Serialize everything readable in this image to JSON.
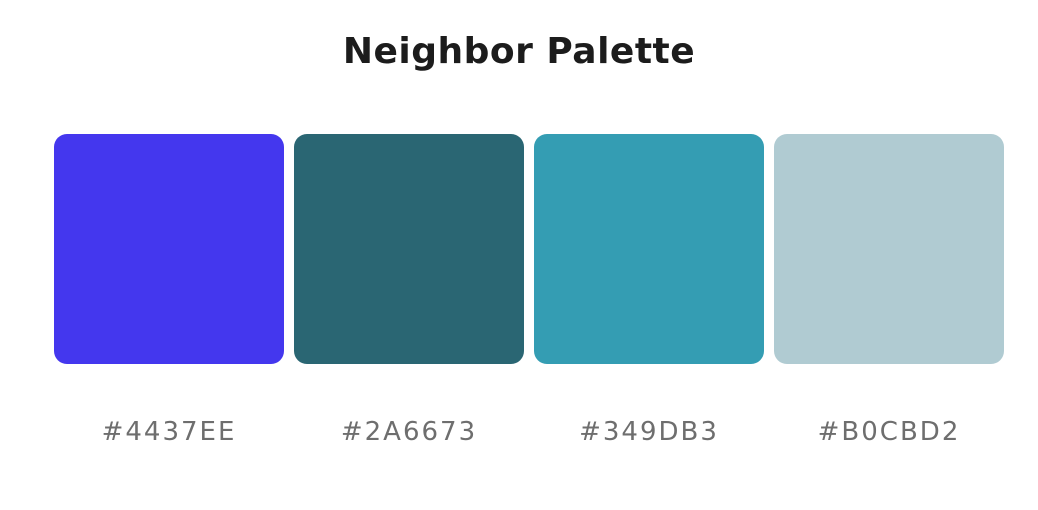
{
  "title": "Neighbor Palette",
  "swatches": [
    {
      "hex": "#4437EE",
      "color": "#4437EE"
    },
    {
      "hex": "#2A6673",
      "color": "#2A6673"
    },
    {
      "hex": "#349DB3",
      "color": "#349DB3"
    },
    {
      "hex": "#B0CBD2",
      "color": "#B0CBD2"
    }
  ]
}
